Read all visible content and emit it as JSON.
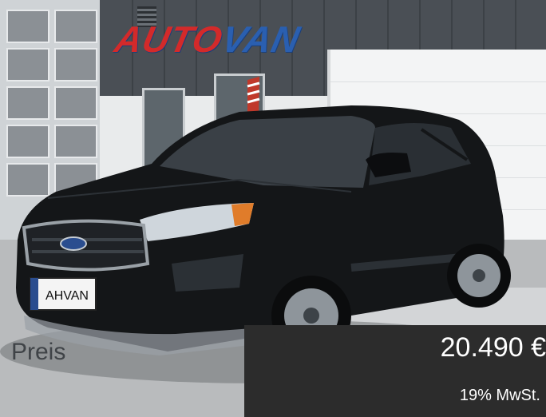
{
  "listing": {
    "dealer_sign": {
      "part1": "AUTO",
      "part2": "VAN"
    },
    "plate_text": "AHVAN",
    "price_label": "Preis",
    "price_value": "20.490 €",
    "tax_note": "19% MwSt."
  },
  "colors": {
    "price_box": "#2c2c2c",
    "price_text": "#ffffff",
    "car_body": "#141618",
    "sign_blue": "#2a5fb0",
    "sign_red": "#d32a2a"
  }
}
